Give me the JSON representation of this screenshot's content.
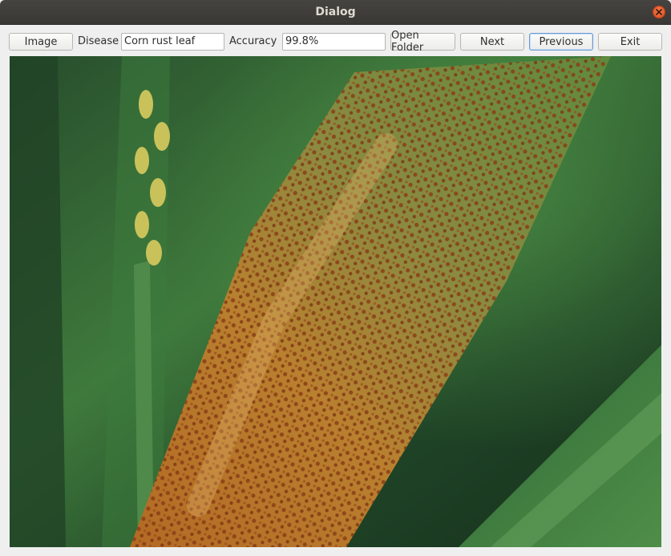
{
  "window": {
    "title": "Dialog"
  },
  "toolbar": {
    "image_button": "Image",
    "disease_label": "Disease",
    "disease_value": "Corn rust leaf",
    "accuracy_label": "Accuracy",
    "accuracy_value": "99.8%",
    "open_folder_button": "Open Folder",
    "next_button": "Next",
    "previous_button": "Previous",
    "exit_button": "Exit"
  },
  "icons": {
    "close": "close-icon"
  },
  "colors": {
    "titlebar": "#3e3d39",
    "close_button": "#e4572b",
    "focus_border": "#6a9bd3"
  }
}
